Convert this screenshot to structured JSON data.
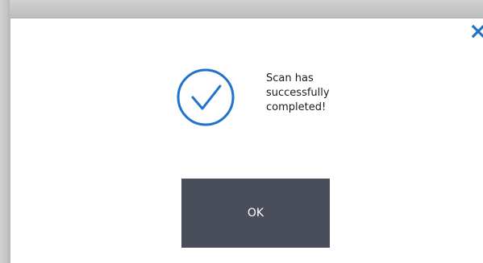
{
  "dialog": {
    "message_lines": [
      "Scan has",
      "successfully",
      "completed!"
    ],
    "ok_label": "OK",
    "close_icon": "close-icon",
    "status_icon": "check-circle-icon"
  },
  "colors": {
    "accent": "#1f73c9",
    "button_bg": "#4a4e5a",
    "button_text": "#ffffff"
  }
}
